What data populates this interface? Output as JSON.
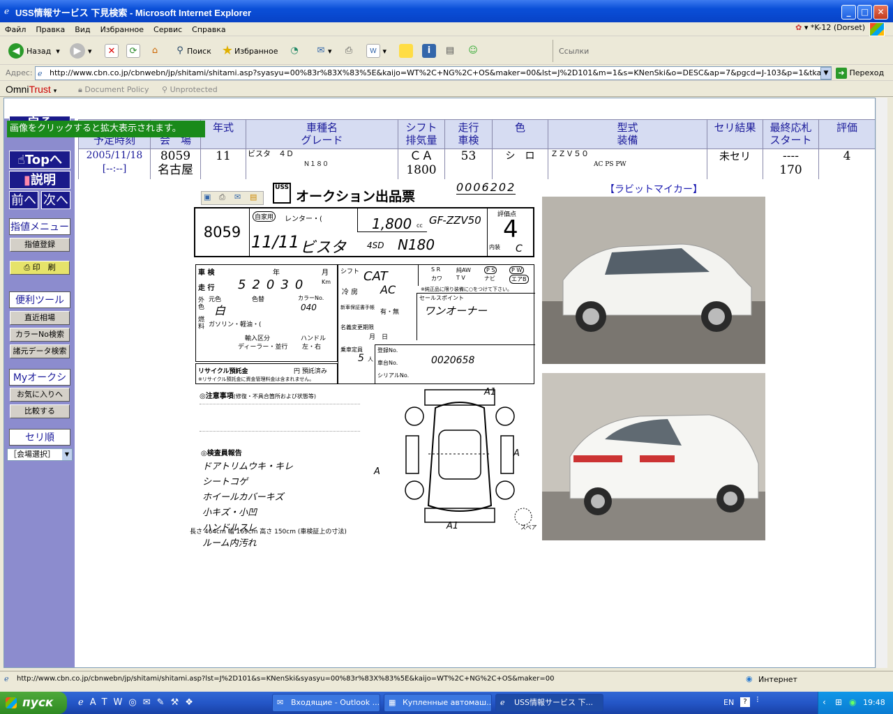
{
  "window": {
    "title": "USS情報サービス 下見検索 - Microsoft Internet Explorer"
  },
  "menu": {
    "items": [
      "Файл",
      "Правка",
      "Вид",
      "Избранное",
      "Сервис",
      "Справка"
    ],
    "right_label": "*K-12 (Dorset)"
  },
  "toolbar": {
    "back_label": "Назад",
    "search_label": "Поиск",
    "favorites_label": "Избранное",
    "links_label": "Ссылки"
  },
  "address": {
    "label": "Адрес:",
    "url": "http://www.cbn.co.jp/cbnwebn/jp/shitami/shitami.asp?syasyu=00%83r%83X%83%5E&kaijo=WT%2C+NG%2C+OS&maker=00&lst=J%2D101&m=1&s=KNenSki&o=DESC&ap=7&pgcd=J-103&p=1&tkaijo=NG&taa=1129&tsyup=",
    "go_label": "Переход"
  },
  "omnitrust": {
    "brand_omni": "Omni",
    "brand_trust": "Trust",
    "doc_policy": "Document Policy",
    "unprotected": "Unprotected"
  },
  "nav": {
    "hint": "画像をクリックすると拡大表示されます。",
    "back": "戻る",
    "top": "Topへ",
    "help": "説明",
    "prev": "前へ",
    "next": "次へ",
    "group1_head": "指値メニュー",
    "group1_items": [
      "指値登録"
    ],
    "print": "印　刷",
    "group2_head": "便利ツール",
    "group2_items": [
      "直近相場",
      "カラーNo検索",
      "諸元データ検索"
    ],
    "group3_head": "Myオークション",
    "group3_items": [
      "お気に入りへ",
      "比較する"
    ],
    "sort_head": "セリ順",
    "venue_select": "［会場選択］"
  },
  "table": {
    "headers": {
      "date": "予定時刻",
      "venue": "会　場",
      "year": "年式",
      "model_line1": "車種名",
      "model_line2": "グレード",
      "shift_line1": "シフト",
      "shift_line2": "排気量",
      "mileage_line1": "走行",
      "mileage_line2": "車検",
      "color": "色",
      "type_line1": "型式",
      "type_line2": "装備",
      "result": "セリ結果",
      "bid_line1": "最終応札",
      "bid_line2": "スタート",
      "rating": "評価"
    },
    "row": {
      "date": "2005/11/18",
      "time": "[--:--]",
      "lot": "8059",
      "venue": "名古屋",
      "year": "11",
      "model": "ビスタ　４Ｄ",
      "grade": "Ｎ１８０",
      "shift": "ＣＡ",
      "displacement": "1800",
      "mileage": "53",
      "color": "シ　ロ",
      "type": "ＺＺＶ５０",
      "equipment": "AC PS PW",
      "result": "未セリ",
      "last_bid": "----",
      "start": "170",
      "rating": "4"
    }
  },
  "sheet": {
    "title": "オークション出品票",
    "serial": "0006202",
    "logo": "USS",
    "lot": "8059",
    "use_label": "自家用",
    "rental_label": "レンター・(",
    "reg_date": "11/11",
    "model": "ビスタ",
    "body": "4SD",
    "grade": "N180",
    "displacement": "1,800",
    "displacement_unit": "cc",
    "type": "GF-ZZV50",
    "score_label": "評価点",
    "score": "4",
    "interior_label": "内装",
    "interior": "C",
    "shaken_label": "車 検",
    "year_label": "年",
    "month_label": "月",
    "mileage_label": "走 行",
    "mileage_digits": [
      "5",
      "2",
      "0",
      "3",
      "0"
    ],
    "mileage_unit": "Km",
    "ext_label": "外色",
    "color_orig": "元色",
    "color_now": "色替",
    "color_value": "白",
    "color_no_label": "カラーNo.",
    "color_no": "040",
    "fuel_label": "燃料",
    "fuel_value": "ガソリン・軽油・(",
    "import_label": "輸入区分",
    "import_value": "ディーラー・並行",
    "handle_label": "ハンドル",
    "handle_value": "左・右",
    "recycle_label": "リサイクル預託金",
    "recycle_value": "円 預託済み",
    "recycle_note": "※リサイクル預託金に資金管理料金は含まれません。",
    "shift_label": "シフト",
    "shift_value": "CAT",
    "ac_label": "冷 房",
    "ac_value": "AC",
    "equip": [
      "S R",
      "純AW",
      "P S",
      "P W",
      "カワ",
      "T V",
      "ナビ",
      "エアB"
    ],
    "equip_note": "※純正品に限り装備に○をつけて下さい。",
    "sales_point_label": "セールスポイント",
    "sales_point": "ワンオーナー",
    "warranty_label": "新車保証書手帳",
    "warranty_value": "有・無",
    "rename_label": "名義変更期限",
    "rename_value": "月　日",
    "capacity_label": "乗車定員",
    "capacity": "5",
    "capacity_unit": "人",
    "reg_no_label": "登録No.",
    "chassis_label": "車台No.",
    "chassis": "0020658",
    "serial_label": "シリアルNo.",
    "notes_label": "◎注意事項",
    "notes_sub": "(修復・不具合箇所および状態等)",
    "inspector_label": "◎検査員報告",
    "inspector_lines": [
      "ドアトリムウキ・キレ",
      "シートコゲ",
      "ホイールカバーキズ",
      "小キズ・小凹",
      "ハンドルスレ",
      "ルーム内汚れ"
    ],
    "dims": "長さ 464cm  幅 169cm  高さ 150cm",
    "dims_note": "(車検証上の寸法)",
    "spare_label": "スペア",
    "damage_marks": [
      "A1",
      "A",
      "A",
      "A1"
    ]
  },
  "photos": {
    "caption": "【ラビットマイカー】"
  },
  "status": {
    "url": "http://www.cbn.co.jp/cbnwebn/jp/shitami/shitami.asp?lst=J%2D101&s=KNenSki&syasyu=00%83r%83X%83%5E&kaijo=WT%2C+NG%2C+OS&maker=00",
    "zone": "Интернет"
  },
  "taskbar": {
    "start": "пуск",
    "tasks": [
      "Входящие - Outlook ...",
      "Купленные автомаш...",
      "USS情報サービス 下..."
    ],
    "lang": "EN",
    "clock": "19:48"
  }
}
